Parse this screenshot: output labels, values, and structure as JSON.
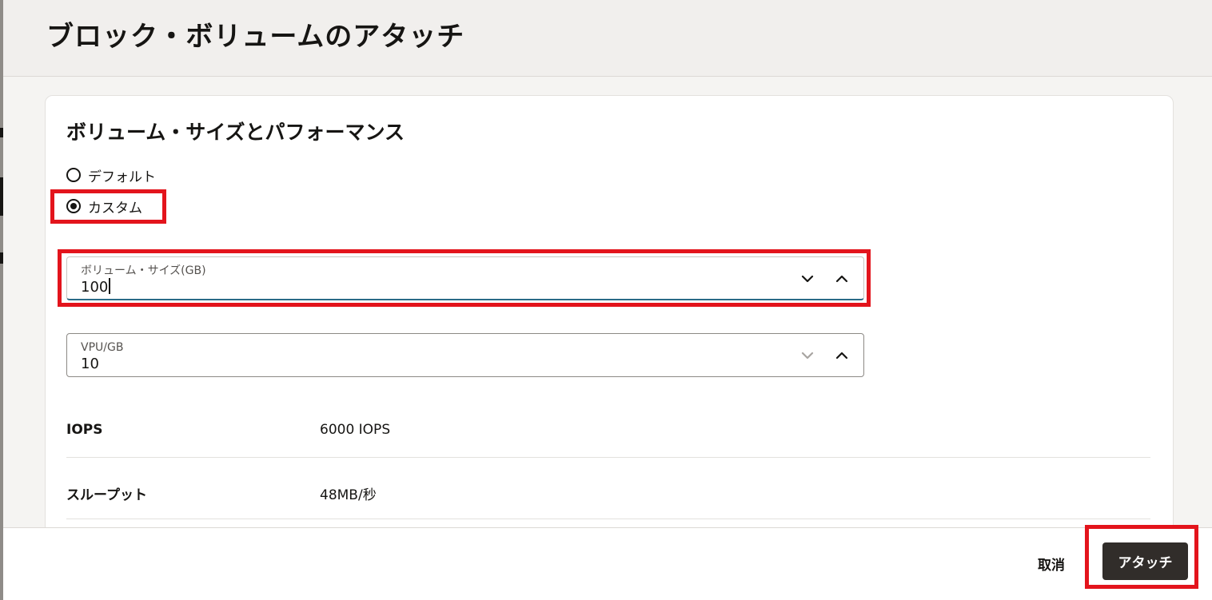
{
  "dialog": {
    "title": "ブロック・ボリュームのアタッチ"
  },
  "section": {
    "title": "ボリューム・サイズとパフォーマンス",
    "options": [
      {
        "label": "デフォルト",
        "selected": false
      },
      {
        "label": "カスタム",
        "selected": true
      }
    ]
  },
  "volume_size": {
    "label": "ボリューム・サイズ(GB)",
    "value": "100"
  },
  "vpu": {
    "label": "VPU/GB",
    "value": "10"
  },
  "details": [
    {
      "label": "IOPS",
      "value": "6000 IOPS"
    },
    {
      "label": "スループット",
      "value": "48MB/秒"
    }
  ],
  "footer": {
    "cancel_label": "取消",
    "attach_label": "アタッチ"
  },
  "colors": {
    "highlight": "#e3141c",
    "primary_button": "#312d2a",
    "focus_underline": "#2b6b87"
  },
  "icons": {
    "decrement": "chevron-down-icon",
    "increment": "chevron-up-icon"
  }
}
